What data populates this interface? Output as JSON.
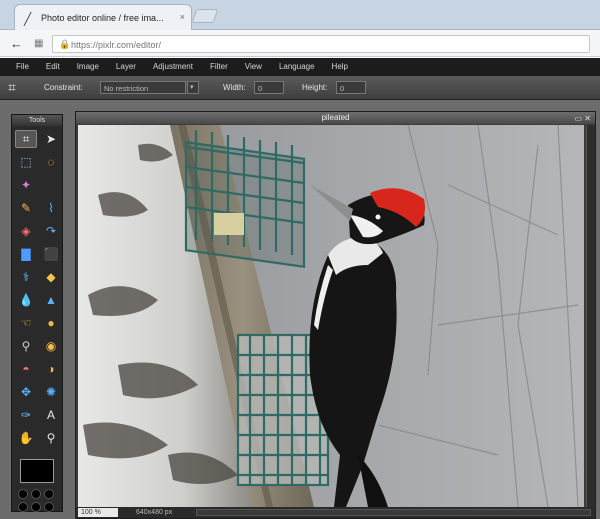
{
  "browser": {
    "tab_title": "Photo editor online / free ima...",
    "tab_close": "×",
    "back_icon": "←",
    "url": "https://pixlr.com/editor/"
  },
  "menu": [
    "File",
    "Edit",
    "Image",
    "Layer",
    "Adjustment",
    "Filter",
    "View",
    "Language",
    "Help"
  ],
  "options": {
    "constraint_label": "Constraint:",
    "constraint_value": "No restriction",
    "width_label": "Width:",
    "width_value": "0",
    "height_label": "Height:",
    "height_value": "0"
  },
  "tools": {
    "title": "Tools",
    "items": [
      {
        "name": "crop-icon",
        "glyph": "⌗",
        "color": "#e6e6e6"
      },
      {
        "name": "move-icon",
        "glyph": "➤",
        "color": "#e6e6e6"
      },
      {
        "name": "marquee-icon",
        "glyph": "⬚",
        "color": "#9ad0ff"
      },
      {
        "name": "lasso-icon",
        "glyph": "◌",
        "color": "#f2b84b"
      },
      {
        "name": "wand-icon",
        "glyph": "✦",
        "color": "#d77bd6"
      },
      {
        "name": "blank",
        "glyph": "",
        "color": "#888"
      },
      {
        "name": "pencil-icon",
        "glyph": "✎",
        "color": "#f2b84b"
      },
      {
        "name": "brush-icon",
        "glyph": "⌇",
        "color": "#5ab1ff"
      },
      {
        "name": "eraser-icon",
        "glyph": "◈",
        "color": "#ff6b6b"
      },
      {
        "name": "drop-icon",
        "glyph": "↷",
        "color": "#5ab1ff"
      },
      {
        "name": "gradient-icon",
        "glyph": "▇",
        "color": "#4a9cff"
      },
      {
        "name": "stamp-icon",
        "glyph": "⬛",
        "color": "#f2a84b"
      },
      {
        "name": "colorpick-icon",
        "glyph": "⚕",
        "color": "#66c6ff"
      },
      {
        "name": "sponge-icon",
        "glyph": "◆",
        "color": "#f5c64b"
      },
      {
        "name": "blur-icon",
        "glyph": "💧",
        "color": "#5ab1ff"
      },
      {
        "name": "sharpen-icon",
        "glyph": "▲",
        "color": "#5ab1ff"
      },
      {
        "name": "smudge-icon",
        "glyph": "☜",
        "color": "#f2b84b"
      },
      {
        "name": "bucket-icon",
        "glyph": "●",
        "color": "#f5b84b"
      },
      {
        "name": "zoom-icon",
        "glyph": "⚲",
        "color": "#cccccc"
      },
      {
        "name": "burn-icon",
        "glyph": "◉",
        "color": "#f5b84b"
      },
      {
        "name": "redeye-icon",
        "glyph": "◓",
        "color": "#ff7070"
      },
      {
        "name": "dodge-icon",
        "glyph": "◑",
        "color": "#f5b84b"
      },
      {
        "name": "heal-icon",
        "glyph": "✥",
        "color": "#5ab1ff"
      },
      {
        "name": "pinch-icon",
        "glyph": "✺",
        "color": "#5ab1ff"
      },
      {
        "name": "eyedrop-icon",
        "glyph": "✑",
        "color": "#66c6ff"
      },
      {
        "name": "text-icon",
        "glyph": "A",
        "color": "#e6e6e6"
      },
      {
        "name": "hand-icon",
        "glyph": "✋",
        "color": "#f5c64b"
      },
      {
        "name": "magnify-icon",
        "glyph": "⚲",
        "color": "#e6e6e6"
      }
    ]
  },
  "document": {
    "title": "pileated",
    "win_buttons": "▭ ✕"
  },
  "status": {
    "zoom": "100 %",
    "size": "640x480 px"
  },
  "colors": {
    "menubar": "#1c1c1c",
    "panel": "#2a2a2a",
    "crest": "#d8261d"
  }
}
